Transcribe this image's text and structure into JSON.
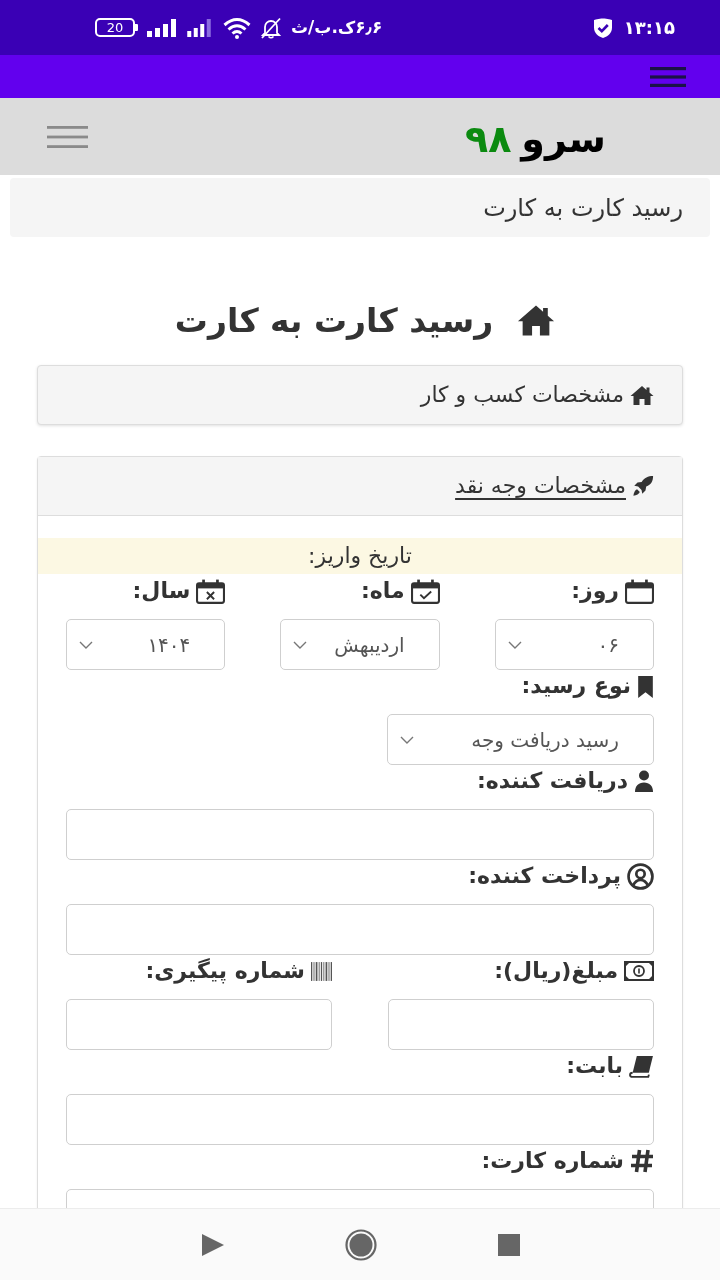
{
  "status_bar": {
    "battery": "20",
    "network_speed": "۶٫۶ک.ب/ث",
    "time": "۱۳:۱۵"
  },
  "header": {
    "logo_word": "سرو",
    "logo_number": "۹۸"
  },
  "breadcrumb": [
    "رسید کارت به کارت"
  ],
  "page_title": "رسید کارت به کارت",
  "panels": [
    {
      "title": "مشخصات کسب و کار",
      "expanded": false
    },
    {
      "title": "مشخصات وجه نقد",
      "expanded": true,
      "form": {
        "date_heading": "تاریخ واریز:",
        "date_fields": [
          {
            "kind": "select",
            "label": "روز:",
            "value": "۰۶"
          },
          {
            "kind": "select",
            "label": "ماه:",
            "value": "اردیبهش"
          },
          {
            "kind": "select",
            "label": "سال:",
            "value": "۱۴۰۴"
          }
        ],
        "fields": [
          {
            "kind": "select",
            "label": "نوع رسید:",
            "value": "رسید دریافت وجه"
          },
          {
            "kind": "text",
            "label": "دریافت کننده:"
          },
          {
            "kind": "text",
            "label": "پرداخت کننده:"
          },
          {
            "kind": "pair",
            "fields": [
              {
                "kind": "text",
                "label": "مبلغ(ریال):"
              },
              {
                "kind": "text",
                "label": "شماره پیگیری:"
              }
            ]
          },
          {
            "kind": "text",
            "label": "بابت:"
          },
          {
            "kind": "text",
            "label": "شماره کارت:"
          }
        ]
      }
    }
  ]
}
